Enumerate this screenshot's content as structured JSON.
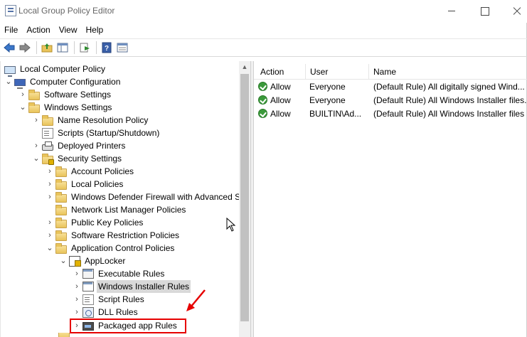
{
  "window": {
    "title": "Local Group Policy Editor",
    "icon": "policy-editor-icon",
    "controls": [
      "minimize",
      "maximize",
      "close"
    ]
  },
  "menu": [
    "File",
    "Action",
    "View",
    "Help"
  ],
  "toolbar": {
    "buttons": [
      "back-icon",
      "forward-icon",
      "up-folder-icon",
      "show-hide-tree-icon",
      "export-list-icon",
      "help-icon",
      "properties-icon"
    ]
  },
  "tree": {
    "items": [
      {
        "label": "Local Computer Policy",
        "icon": "computer-icon",
        "expanded": null
      },
      {
        "label": "Computer Configuration",
        "icon": "computer-config-icon",
        "expanded": true
      },
      {
        "label": "Software Settings",
        "icon": "folder-icon",
        "expanded": false
      },
      {
        "label": "Windows Settings",
        "icon": "folder-icon",
        "expanded": true
      },
      {
        "label": "Name Resolution Policy",
        "icon": "folder-icon",
        "expanded": false
      },
      {
        "label": "Scripts (Startup/Shutdown)",
        "icon": "script-icon",
        "expanded": null
      },
      {
        "label": "Deployed Printers",
        "icon": "printer-icon",
        "expanded": false
      },
      {
        "label": "Security Settings",
        "icon": "security-folder-icon",
        "expanded": true
      },
      {
        "label": "Account Policies",
        "icon": "folder-icon",
        "expanded": false
      },
      {
        "label": "Local Policies",
        "icon": "folder-icon",
        "expanded": false
      },
      {
        "label": "Windows Defender Firewall with Advanced S",
        "icon": "folder-icon",
        "expanded": false
      },
      {
        "label": "Network List Manager Policies",
        "icon": "folder-icon",
        "expanded": null
      },
      {
        "label": "Public Key Policies",
        "icon": "folder-icon",
        "expanded": false
      },
      {
        "label": "Software Restriction Policies",
        "icon": "folder-icon",
        "expanded": false
      },
      {
        "label": "Application Control Policies",
        "icon": "folder-icon",
        "expanded": true
      },
      {
        "label": "AppLocker",
        "icon": "applocker-icon",
        "expanded": true
      },
      {
        "label": "Executable Rules",
        "icon": "rules-icon",
        "expanded": false
      },
      {
        "label": "Windows Installer Rules",
        "icon": "installer-rules-icon",
        "expanded": false,
        "selected": true
      },
      {
        "label": "Script Rules",
        "icon": "script-rules-icon",
        "expanded": false
      },
      {
        "label": "DLL Rules",
        "icon": "dll-rules-icon",
        "expanded": false
      },
      {
        "label": "Packaged app Rules",
        "icon": "packaged-app-icon",
        "expanded": false,
        "highlighted": true
      }
    ]
  },
  "list": {
    "columns": [
      "Action",
      "User",
      "Name"
    ],
    "rows": [
      {
        "action": "Allow",
        "user": "Everyone",
        "name": "(Default Rule) All digitally signed Wind..."
      },
      {
        "action": "Allow",
        "user": "Everyone",
        "name": "(Default Rule) All Windows Installer files..."
      },
      {
        "action": "Allow",
        "user": "BUILTIN\\Ad...",
        "name": "(Default Rule) All Windows Installer files"
      }
    ]
  },
  "annotation": {
    "color": "#e60000"
  }
}
